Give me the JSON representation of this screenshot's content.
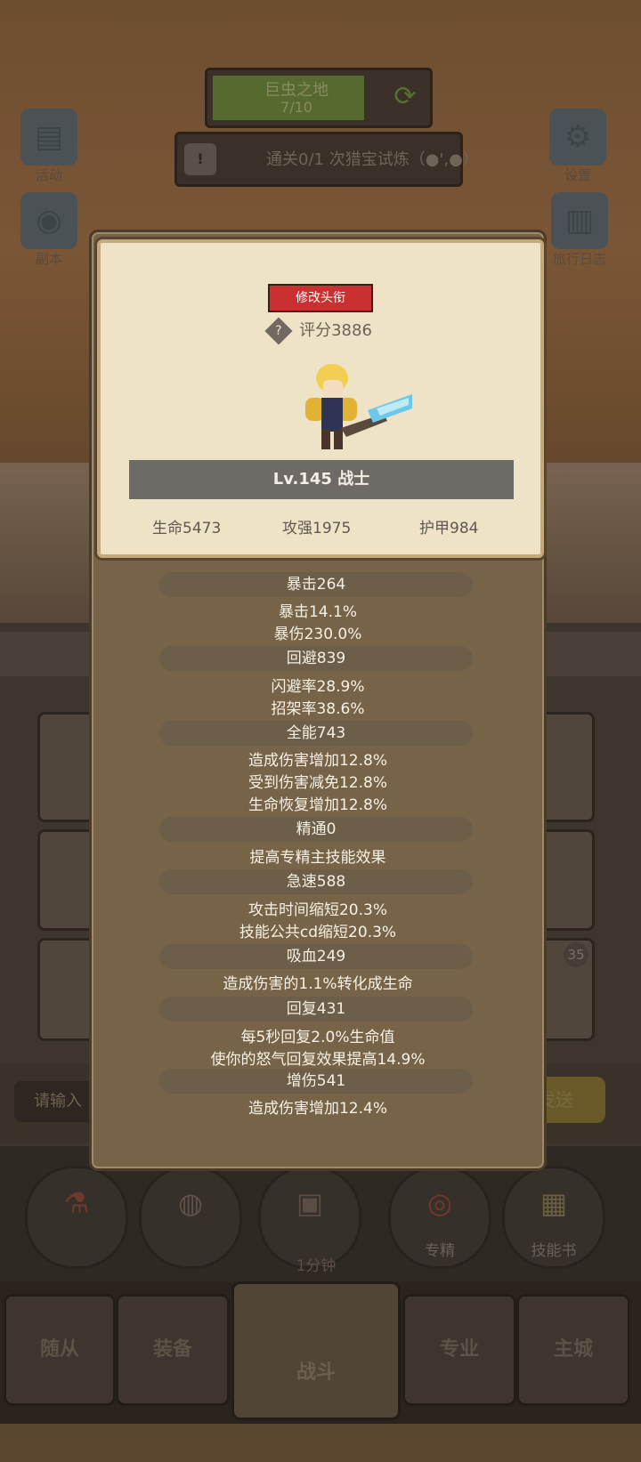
{
  "background": {
    "level": {
      "name": "巨虫之地",
      "progress": "7/10"
    },
    "task": {
      "text": "通关0/1 次猎宝试炼（●',●）"
    },
    "top_icons": [
      "活动",
      "设置",
      "副本",
      "旅行日志"
    ],
    "chat": {
      "placeholder": "请输入",
      "send": "发送"
    },
    "actions": [
      {
        "label": ""
      },
      {
        "label": ""
      },
      {
        "label": ""
      },
      {
        "label": "专精"
      },
      {
        "label": "技能书"
      }
    ],
    "timer": "1分钟",
    "badge": "35",
    "tabs": [
      "随从",
      "装备",
      "战斗",
      "专业",
      "主城"
    ]
  },
  "panel": {
    "title_button": "修改头衔",
    "score": "评分3886",
    "level_banner": "Lv.145 战士",
    "base_stats": {
      "hp": "生命5473",
      "atk": "攻强1975",
      "armor": "护甲984"
    },
    "stats": [
      {
        "header": "暴击264",
        "lines": [
          "暴击14.1%",
          "暴伤230.0%"
        ]
      },
      {
        "header": "回避839",
        "lines": [
          "闪避率28.9%",
          "招架率38.6%"
        ]
      },
      {
        "header": "全能743",
        "lines": [
          "造成伤害增加12.8%",
          "受到伤害减免12.8%",
          "生命恢复增加12.8%"
        ]
      },
      {
        "header": "精通0",
        "lines": [
          "提高专精主技能效果"
        ]
      },
      {
        "header": "急速588",
        "lines": [
          "攻击时间缩短20.3%",
          "技能公共cd缩短20.3%"
        ]
      },
      {
        "header": "吸血249",
        "lines": [
          "造成伤害的1.1%转化成生命"
        ]
      },
      {
        "header": "回复431",
        "lines": [
          "每5秒回复2.0%生命值",
          "使你的怒气回复效果提高14.9%"
        ]
      },
      {
        "header": "增伤541",
        "lines": [
          "造成伤害增加12.4%"
        ]
      }
    ]
  }
}
